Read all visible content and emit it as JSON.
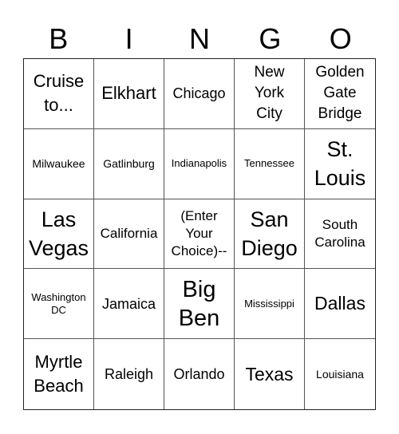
{
  "header": {
    "letters": [
      "B",
      "I",
      "N",
      "G",
      "O"
    ]
  },
  "cells": [
    {
      "text": "Cruise to..."
    },
    {
      "text": "Elkhart"
    },
    {
      "text": "Chicago"
    },
    {
      "text": "New York City"
    },
    {
      "text": "Golden Gate Bridge"
    },
    {
      "text": "Milwaukee"
    },
    {
      "text": "Gatlinburg"
    },
    {
      "text": "Indianapolis"
    },
    {
      "text": "Tennessee"
    },
    {
      "text": "St. Louis"
    },
    {
      "text": "Las Vegas"
    },
    {
      "text": "California"
    },
    {
      "text": "(Enter Your Choice)--"
    },
    {
      "text": "San Diego"
    },
    {
      "text": "South Carolina"
    },
    {
      "text": "Washington DC"
    },
    {
      "text": "Jamaica"
    },
    {
      "text": "Big Ben"
    },
    {
      "text": "Mississippi"
    },
    {
      "text": "Dallas"
    },
    {
      "text": "Myrtle Beach"
    },
    {
      "text": "Raleigh"
    },
    {
      "text": "Orlando"
    },
    {
      "text": "Texas"
    },
    {
      "text": "Louisiana"
    }
  ]
}
